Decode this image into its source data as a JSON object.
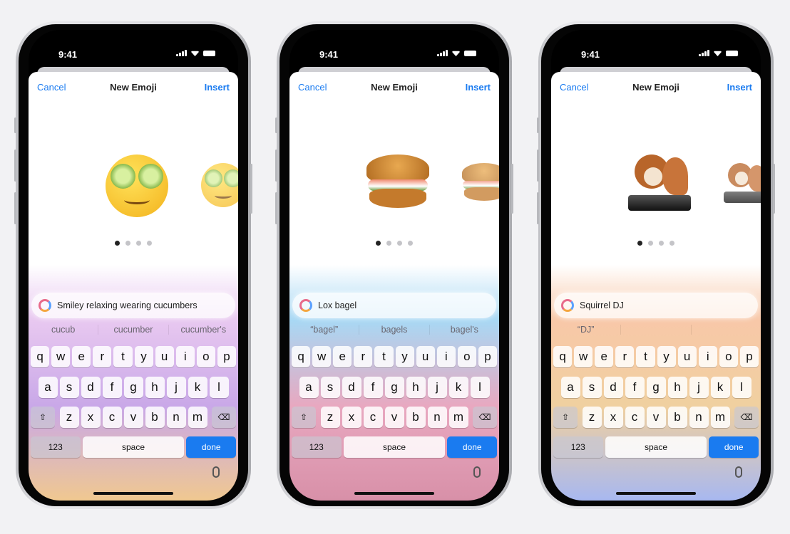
{
  "status": {
    "time": "9:41"
  },
  "nav": {
    "cancel": "Cancel",
    "title": "New Emoji",
    "insert": "Insert"
  },
  "keyboard": {
    "rows": [
      [
        "q",
        "w",
        "e",
        "r",
        "t",
        "y",
        "u",
        "i",
        "o",
        "p"
      ],
      [
        "a",
        "s",
        "d",
        "f",
        "g",
        "h",
        "j",
        "k",
        "l"
      ],
      [
        "z",
        "x",
        "c",
        "v",
        "b",
        "n",
        "m"
      ]
    ],
    "numbers": "123",
    "space": "space",
    "done": "done",
    "shift_icon": "shift-icon",
    "delete_icon": "delete-icon",
    "mic_icon": "microphone-icon"
  },
  "accent": "#1a7bf0",
  "phones": [
    {
      "prompt": "Smiley relaxing wearing cucumbers",
      "suggestions": [
        "cucub",
        "cucumber",
        "cucumber's"
      ],
      "emoji": "smiley-with-cucumbers",
      "page": 1,
      "pages": 4,
      "gradient": [
        "#ffffff",
        "#e8c8f0",
        "#c9a8e8",
        "#f0c890"
      ]
    },
    {
      "prompt": "Lox bagel",
      "suggestions": [
        "“bagel”",
        "bagels",
        "bagel's"
      ],
      "emoji": "lox-bagel",
      "page": 1,
      "pages": 4,
      "gradient": [
        "#ffffff",
        "#a8d8f4",
        "#e8a8c0",
        "#d890a8"
      ]
    },
    {
      "prompt": "Squirrel DJ",
      "suggestions": [
        "“DJ”",
        "",
        ""
      ],
      "emoji": "squirrel-dj",
      "page": 1,
      "pages": 4,
      "gradient": [
        "#ffffff",
        "#f8c8a8",
        "#f0d0a0",
        "#a8b8f0"
      ]
    }
  ]
}
